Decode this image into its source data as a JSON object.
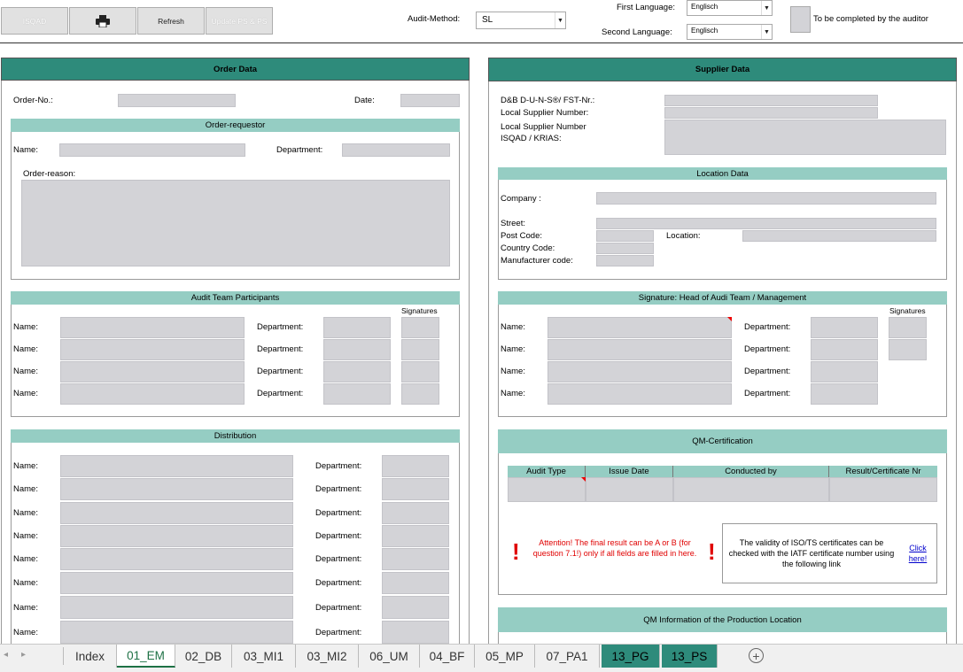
{
  "toolbar": {
    "isqad_label": "ISQAD",
    "refresh_label": "Refresh",
    "update_label": "Update PS & PS"
  },
  "audit_method": {
    "label": "Audit-Method:",
    "value": "SL"
  },
  "first_language": {
    "label": "First Language:",
    "value": "Englisch"
  },
  "second_language": {
    "label": "Second Language:",
    "value": "Englisch"
  },
  "auditor_note": "To be completed by the auditor",
  "order": {
    "title": "Order Data",
    "order_no_label": "Order-No.:",
    "date_label": "Date:",
    "requestor_title": "Order-requestor",
    "name_label": "Name:",
    "department_label": "Department:",
    "reason_label": "Order-reason:",
    "team_title": "Audit Team Participants",
    "signatures_label": "Signatures",
    "distribution_title": "Distribution"
  },
  "supplier": {
    "title": "Supplier Data",
    "duns_label": "D&B D-U-N-S®/ FST-Nr.:",
    "local_supplier_label": "Local Supplier Number:",
    "isqad_label": "Local Supplier Number ISQAD / KRIAS:",
    "location_title": "Location Data",
    "company_label": "Company  :",
    "street_label": "Street:",
    "post_code_label": "Post Code:",
    "location_label": "Location:",
    "country_code_label": "Country Code:",
    "manufacturer_code_label": "Manufacturer code:",
    "signature_title": "Signature: Head of Audi Team / Management",
    "signatures_label": "Signatures",
    "name_label": "Name:",
    "department_label": "Department:",
    "qm_title": "QM-Certification",
    "qm_columns": [
      "Audit Type",
      "Issue Date",
      "Conducted by",
      "Result/Certificate Nr"
    ],
    "attention_text": "Attention! The final result can be A or B (for question 7.1!) only if all fields are filled in here.",
    "validity_text": "The validity of ISO/TS certificates can be checked with the IATF certificate number using the following link",
    "click_here": "Click here!",
    "qm_info_title": "QM Information of the Production Location"
  },
  "tabs": [
    "Index",
    "01_EM",
    "02_DB",
    "03_MI1",
    "03_MI2",
    "06_UM",
    "04_BF",
    "05_MP",
    "07_PA1",
    "13_PG",
    "13_PS"
  ],
  "active_tab": "01_EM",
  "colors": {
    "header_dark": "#2e8b7b",
    "header_light": "#95cdc3",
    "field": "#d3d3d7",
    "attention": "#e00000"
  }
}
